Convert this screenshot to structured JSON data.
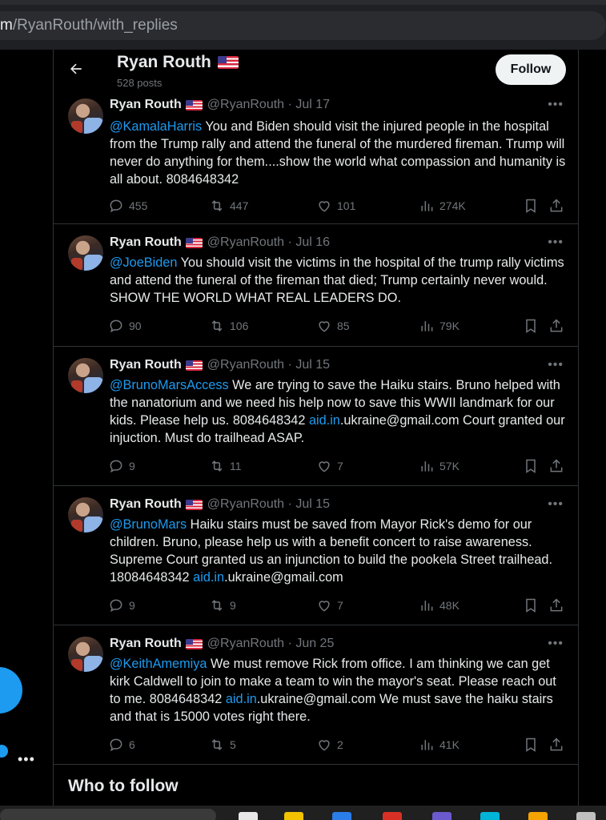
{
  "browser": {
    "url_prefix": "m",
    "url_rest": "/RyanRouth/with_replies"
  },
  "header": {
    "name": "Ryan Routh",
    "flag_icon": "us-flag-icon",
    "post_count": "528 posts",
    "follow_label": "Follow"
  },
  "tweets": [
    {
      "name": "Ryan Routh",
      "handle": "@RyanRouth",
      "sep": "·",
      "date": "Jul 17",
      "mention": "@KamalaHarris",
      "text": " You and Biden should visit the injured people in the hospital from the Trump rally and attend the funeral of the murdered fireman. Trump will never do anything for them....show the world what compassion and humanity is all about. 8084648342",
      "link": "",
      "after_link": "",
      "replies": "455",
      "reposts": "447",
      "likes": "101",
      "views": "274K"
    },
    {
      "name": "Ryan Routh",
      "handle": "@RyanRouth",
      "sep": "·",
      "date": "Jul 16",
      "mention": "@JoeBiden",
      "text": " You should visit the victims in the hospital of the trump rally victims and attend the funeral of the fireman that died; Trump certainly never would. SHOW THE WORLD WHAT REAL LEADERS DO.",
      "link": "",
      "after_link": "",
      "replies": "90",
      "reposts": "106",
      "likes": "85",
      "views": "79K"
    },
    {
      "name": "Ryan Routh",
      "handle": "@RyanRouth",
      "sep": "·",
      "date": "Jul 15",
      "mention": "@BrunoMarsAccess",
      "text": " We are trying to save the Haiku stairs. Bruno helped with the nanatorium and we need his help now to save this WWII landmark for our kids. Please help us. 8084648342 ",
      "link": "aid.in",
      "after_link": ".ukraine@gmail.com Court granted our injuction. Must do trailhead ASAP.",
      "replies": "9",
      "reposts": "11",
      "likes": "7",
      "views": "57K"
    },
    {
      "name": "Ryan Routh",
      "handle": "@RyanRouth",
      "sep": "·",
      "date": "Jul 15",
      "mention": "@BrunoMars",
      "text": " Haiku stairs must be saved from Mayor Rick's demo for our children. Bruno, please help us with a benefit concert to raise awareness. Supreme Court granted us an injunction to build the pookela Street trailhead. 18084648342 ",
      "link": "aid.in",
      "after_link": ".ukraine@gmail.com",
      "replies": "9",
      "reposts": "9",
      "likes": "7",
      "views": "48K"
    },
    {
      "name": "Ryan Routh",
      "handle": "@RyanRouth",
      "sep": "·",
      "date": "Jun 25",
      "mention": "@KeithAmemiya",
      "text": " We must remove Rick from office. I am thinking we can get kirk Caldwell to join to make a team to win the mayor's seat. Please reach out to me. 8084648342 ",
      "link": "aid.in",
      "after_link": ".ukraine@gmail.com We must save the haiku stairs and that is 15000 votes right there.",
      "replies": "6",
      "reposts": "5",
      "likes": "2",
      "views": "41K"
    }
  ],
  "sidebar": {
    "who_to_follow": "Who to follow"
  },
  "colors": {
    "background": "#000000",
    "accent": "#1d9bf0",
    "muted": "#71767b",
    "text": "#e7e9ea",
    "border": "#2f3336"
  }
}
